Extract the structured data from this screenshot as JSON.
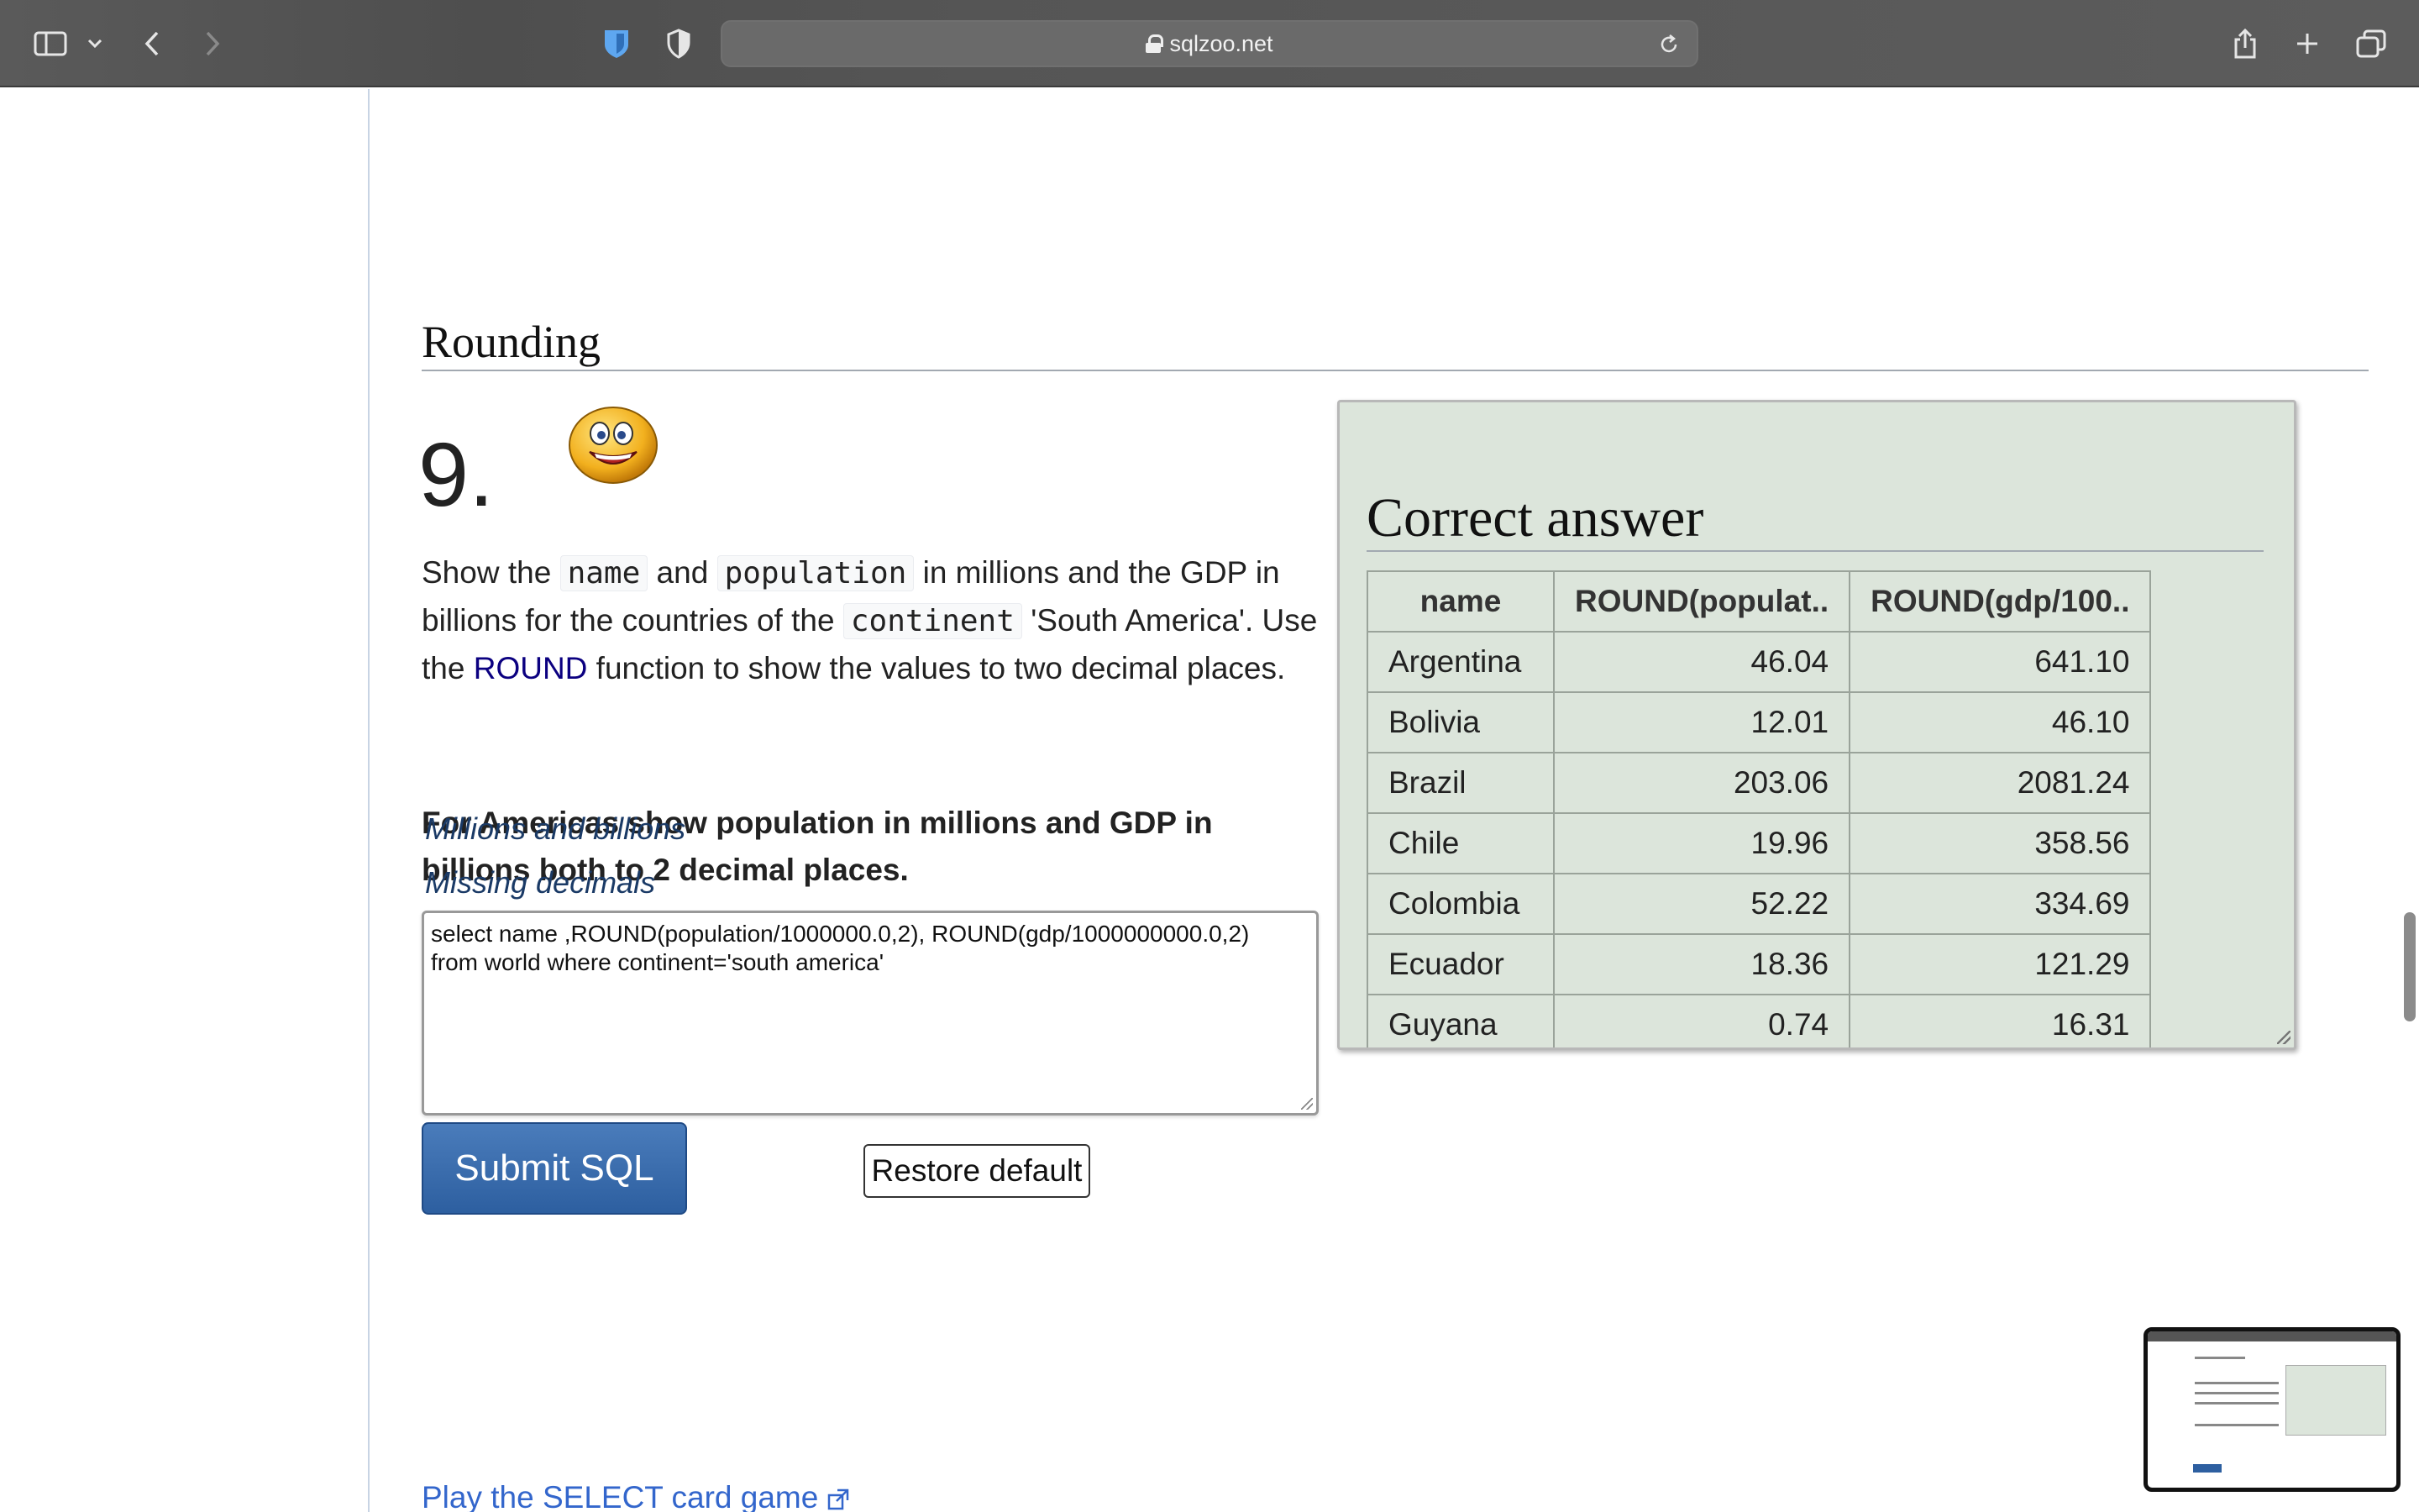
{
  "browser": {
    "url": "sqlzoo.net",
    "icons": [
      "sidebar-icon",
      "chevron-down-icon",
      "back-icon",
      "forward-icon",
      "bitwarden-icon",
      "privacy-shield-icon",
      "lock-icon",
      "reload-icon",
      "share-icon",
      "new-tab-icon",
      "tabs-overview-icon"
    ]
  },
  "section": {
    "title": "Rounding"
  },
  "question": {
    "number": "9.",
    "text_part1": "Show the ",
    "code_name": "name",
    "text_part2": " and ",
    "code_population": "population",
    "text_part3": " in millions and the GDP in billions for the countries of the ",
    "code_continent": "continent",
    "text_part4": " 'South America'. Use the ",
    "link_round": "ROUND",
    "text_part5": " function to show the values to two decimal places.",
    "bold_note": "For Americas show population in millions and GDP in billions both to 2 decimal places.",
    "hints": [
      "Millions and billions",
      "Missing decimals"
    ]
  },
  "editor": {
    "sql": "select name ,ROUND(population/1000000.0,2), ROUND(gdp/1000000000.0,2)\nfrom world where continent='south america'"
  },
  "buttons": {
    "submit": "Submit SQL",
    "restore": "Restore default"
  },
  "answer": {
    "title": "Correct answer",
    "columns": [
      "name",
      "ROUND(populat..",
      "ROUND(gdp/100.."
    ],
    "rows": [
      [
        "Argentina",
        "46.04",
        "641.10"
      ],
      [
        "Bolivia",
        "12.01",
        "46.10"
      ],
      [
        "Brazil",
        "203.06",
        "2081.24"
      ],
      [
        "Chile",
        "19.96",
        "358.56"
      ],
      [
        "Colombia",
        "52.22",
        "334.69"
      ],
      [
        "Ecuador",
        "18.36",
        "121.29"
      ],
      [
        "Guyana",
        "0.74",
        "16.31"
      ]
    ]
  },
  "footer": {
    "card_link": "Play the SELECT card game"
  },
  "colors": {
    "answer_bg": "#dce5db",
    "submit_bg": "#2d5fa0",
    "link": "#3366cc"
  }
}
